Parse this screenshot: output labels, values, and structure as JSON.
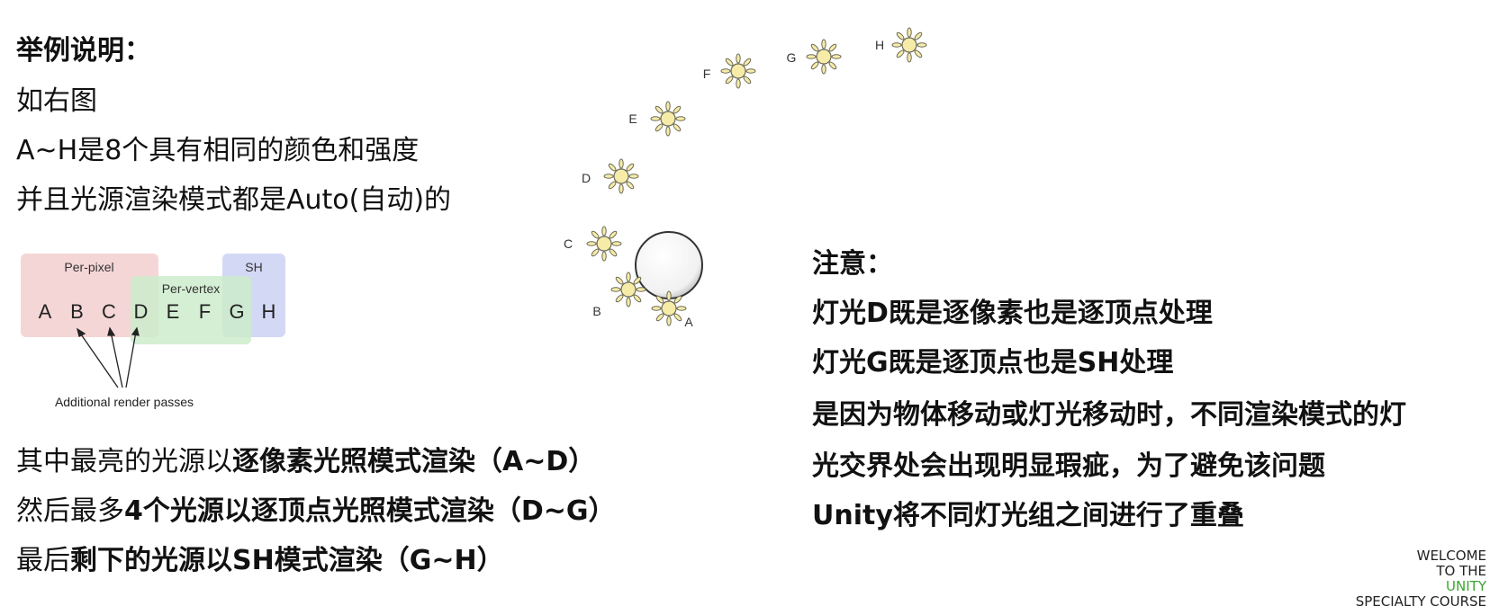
{
  "left_text": {
    "title": "举例说明：",
    "lines": [
      "如右图",
      "A~H是8个具有相同的颜色和强度",
      "并且光源渲染模式都是Auto(自动)的"
    ]
  },
  "diagram_groups": {
    "per_pixel": "Per-pixel",
    "per_vertex": "Per-vertex",
    "sh": "SH",
    "letters": [
      "A",
      "B",
      "C",
      "D",
      "E",
      "F",
      "G",
      "H"
    ],
    "caption": "Additional render passes",
    "colors": {
      "per_pixel": "#f5d6d6",
      "per_vertex": "#cdeccb",
      "sh": "#d3d8f5"
    }
  },
  "bottom_text": [
    {
      "normal": "其中最亮的光源以",
      "bold": "逐像素光照模式渲染（A~D）"
    },
    {
      "normal": "然后最多",
      "bold": "4个光源以逐顶点光照模式渲染（D~G）"
    },
    {
      "normal": "最后",
      "bold": "剩下的光源以SH模式渲染（G~H）"
    }
  ],
  "lights_diagram": {
    "labels": [
      "A",
      "B",
      "C",
      "D",
      "E",
      "F",
      "G",
      "H"
    ],
    "sun_color": "#f7eba8",
    "sun_stroke": "#6b6b5a"
  },
  "notes": {
    "title": "注意：",
    "lines": [
      "灯光D既是逐像素也是逐顶点处理",
      "灯光G既是逐顶点也是SH处理",
      "是因为物体移动或灯光移动时，不同渲染模式的灯",
      "光交界处会出现明显瑕疵，为了避免该问题",
      "Unity将不同灯光组之间进行了重叠"
    ]
  },
  "watermark": {
    "line1": "WELCOME",
    "line2": "TO THE",
    "line3": "UNITY",
    "line4": "SPECIALTY COURSE"
  }
}
